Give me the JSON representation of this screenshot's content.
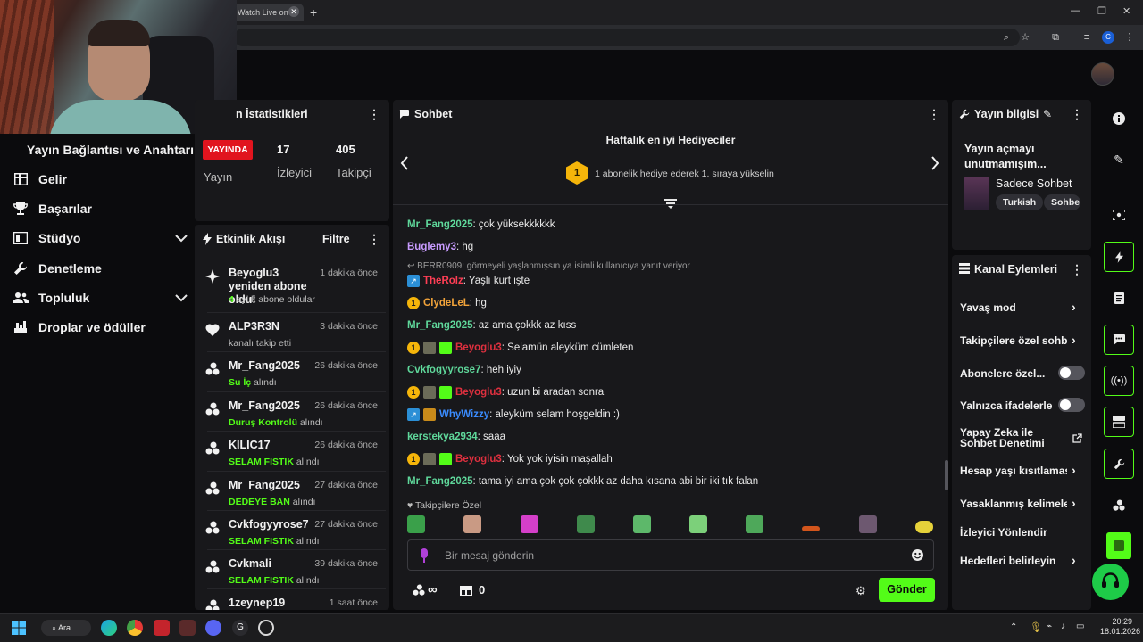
{
  "browser": {
    "tab_title": "Watch Live on K",
    "new_tab": "+"
  },
  "nav": {
    "title": "Yayın Bağlantısı ve Anahtarı",
    "items": [
      {
        "label": "Gelir",
        "icon": "table-icon"
      },
      {
        "label": "Başarılar",
        "icon": "trophy-icon"
      },
      {
        "label": "Stüdyo",
        "icon": "video-icon"
      },
      {
        "label": "Denetleme",
        "icon": "wrench-icon"
      },
      {
        "label": "Topluluk",
        "icon": "users-icon"
      },
      {
        "label": "Droplar ve ödüller",
        "icon": "gift-icon"
      }
    ]
  },
  "stats": {
    "title": "n İstatistikleri",
    "live": "YAYINDA",
    "live_label": "Yayın",
    "viewers": "17",
    "viewers_label": "İzleyici",
    "followers": "405",
    "followers_label": "Takipçi"
  },
  "activity": {
    "title": "Etkinlik Akışı",
    "filter": "Filtre",
    "items": [
      {
        "name": "Beyoglu3 yeniden abone oldu!",
        "time": "1 dakika önce",
        "highlight": "4",
        "sub": " aylık abone oldular"
      },
      {
        "name": "ALP3R3N",
        "time": "3 dakika önce",
        "highlight": "",
        "sub": "kanalı takip etti"
      },
      {
        "name": "Mr_Fang2025",
        "time": "26 dakika önce",
        "highlight": "Su İç",
        "sub": " alındı"
      },
      {
        "name": "Mr_Fang2025",
        "time": "26 dakika önce",
        "highlight": "Duruş Kontrolü",
        "sub": " alındı"
      },
      {
        "name": "KILIC17",
        "time": "26 dakika önce",
        "highlight": "SELAM FISTIK",
        "sub": " alındı"
      },
      {
        "name": "Mr_Fang2025",
        "time": "27 dakika önce",
        "highlight": "DEDEYE BAN",
        "sub": " alındı"
      },
      {
        "name": "Cvkfogyyrose7",
        "time": "27 dakika önce",
        "highlight": "SELAM FISTIK",
        "sub": " alındı"
      },
      {
        "name": "Cvkmali",
        "time": "39 dakika önce",
        "highlight": "SELAM FISTIK",
        "sub": " alındı"
      },
      {
        "name": "1zeynep19",
        "time": "1 saat önce",
        "highlight": "",
        "sub": ""
      }
    ]
  },
  "chat": {
    "title": "Sohbet",
    "gifters_title": "Haftalık en iyi Hediyeciler",
    "gifters_rank": "1",
    "gifters_text": "1 abonelik hediye ederek 1. sıraya yükselin",
    "reply_note": "BERR0909: görmeyeli yaşlanmışsın ya isimli kullanıcıya yanıt veriyor",
    "messages": [
      {
        "user": "Mr_Fang2025",
        "color": "#5fd89b",
        "text": ": çok yüksekkkkkk",
        "badges": []
      },
      {
        "user": "Buglemy3",
        "color": "#c89bff",
        "text": ": hg",
        "badges": []
      },
      {
        "user": "TheRolz",
        "color": "#ff3e55",
        "text": ": Yaşlı kurt işte",
        "badges": [
          "b"
        ]
      },
      {
        "user": "ClydeLeL",
        "color": "#f2a33a",
        "text": ": hg",
        "badges": [
          "1"
        ]
      },
      {
        "user": "Mr_Fang2025",
        "color": "#5fd89b",
        "text": ": az ama çokkk az kıss",
        "badges": []
      },
      {
        "user": "Beyoglu3",
        "color": "#e0303f",
        "text": ": Selamün aleyküm cümleten",
        "badges": [
          "1",
          "p",
          "g"
        ]
      },
      {
        "user": "Cvkfogyyrose7",
        "color": "#5fd89b",
        "text": ": heh iyiy",
        "badges": []
      },
      {
        "user": "Beyoglu3",
        "color": "#e0303f",
        "text": ": uzun bi aradan sonra",
        "badges": [
          "1",
          "p",
          "g"
        ]
      },
      {
        "user": "WhyWizzy",
        "color": "#3a8cff",
        "text": ": aleyküm selam hoşgeldin :)",
        "badges": [
          "b",
          "o"
        ]
      },
      {
        "user": "kerstekya2934",
        "color": "#5fd89b",
        "text": ": saaa",
        "badges": []
      },
      {
        "user": "Beyoglu3",
        "color": "#e0303f",
        "text": ": Yok yok iyisin maşallah",
        "badges": [
          "1",
          "p",
          "g"
        ]
      },
      {
        "user": "Mr_Fang2025",
        "color": "#5fd89b",
        "text": ": tama iyi ama çok çok çokkk az daha kısana abi bir iki tık falan",
        "badges": []
      }
    ],
    "followers_only": "Takipçilere Özel",
    "input_placeholder": "Bir mesaj gönderin",
    "points": "∞",
    "gifts": "0",
    "send": "Gönder"
  },
  "info": {
    "title": "Yayın bilgisi",
    "stream_title": "Yayın açmayı unutmamışım...",
    "category": "Sadece Sohbet",
    "tags": [
      "Turkish",
      "Sohbet"
    ]
  },
  "channel": {
    "title": "Kanal Eylemleri",
    "rows": [
      {
        "label": "Yavaş mod",
        "kind": "chevron"
      },
      {
        "label": "Takipçilere özel sohbet",
        "kind": "chevron"
      },
      {
        "label": "Abonelere özel...",
        "kind": "toggle"
      },
      {
        "label": "Yalnızca ifadelerle",
        "kind": "toggle"
      },
      {
        "label": "Yapay Zeka ile Sohbet Denetimi",
        "kind": "external"
      },
      {
        "label": "Hesap yaşı kısıtlaması",
        "kind": "chevron"
      },
      {
        "label": "Yasaklanmış kelimeler",
        "kind": "chevron"
      },
      {
        "label": "İzleyici Yönlendir",
        "kind": "none"
      },
      {
        "label": "Hedefleri belirleyin",
        "kind": "chevron"
      }
    ]
  },
  "taskbar": {
    "search": "Ara",
    "time": "20:29",
    "date": "18.01.2026"
  },
  "colors": {
    "accent": "#53fc18",
    "live": "#e1141e",
    "panel": "#18181b",
    "background": "#0b0b0d"
  }
}
